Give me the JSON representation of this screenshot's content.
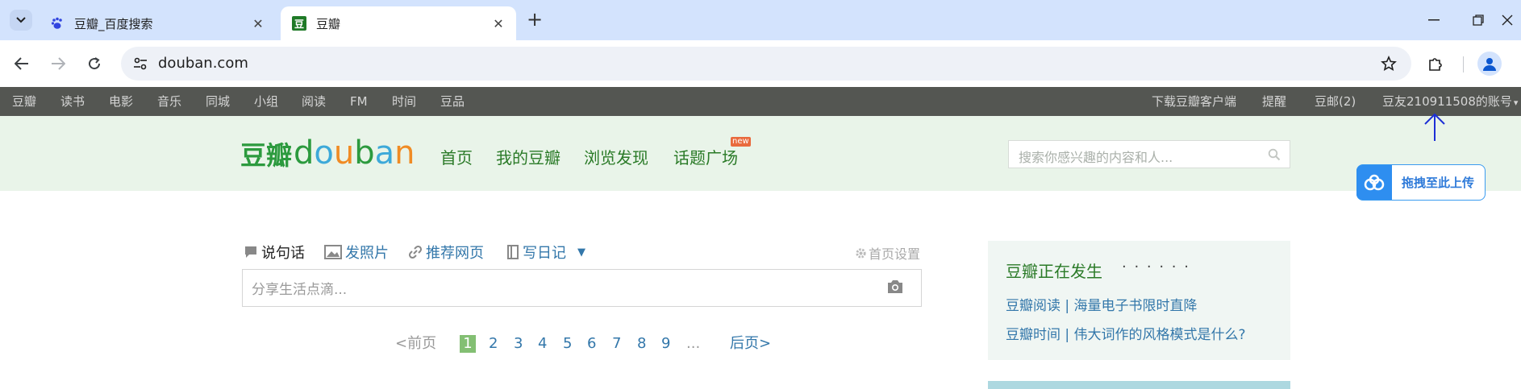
{
  "browser": {
    "tabs": [
      {
        "title": "豆瓣_百度搜索",
        "favicon": "baidu-paw-icon",
        "active": false
      },
      {
        "title": "豆瓣",
        "favicon": "douban-icon",
        "active": true
      }
    ],
    "douban_favicon_glyph": "豆",
    "url": "douban.com"
  },
  "global_nav": {
    "left": [
      "豆瓣",
      "读书",
      "电影",
      "音乐",
      "同城",
      "小组",
      "阅读",
      "FM",
      "时间",
      "豆品"
    ],
    "right": {
      "download": "下载豆瓣客户端",
      "remind": "提醒",
      "mail": "豆邮(2)",
      "account": "豆友210911508的账号",
      "account_caret": "▾"
    }
  },
  "header": {
    "logo_cn": "豆瓣",
    "logo_en_letters": [
      "d",
      "o",
      "u",
      "b",
      "a",
      "n"
    ],
    "logo_en_colors": [
      "#2c9a3e",
      "#3da9d9",
      "#f08b24",
      "#2c9a3e",
      "#3da9d9",
      "#f08b24"
    ],
    "nav": [
      "首页",
      "我的豆瓣",
      "浏览发现",
      "话题广场"
    ],
    "new_badge": "new",
    "search_placeholder": "搜索你感兴趣的内容和人..."
  },
  "upload_widget": {
    "label": "拖拽至此上传"
  },
  "composer": {
    "actions": [
      "说句话",
      "发照片",
      "推荐网页",
      "写日记"
    ],
    "caret": "▼",
    "settings": "首页设置",
    "placeholder": "分享生活点滴..."
  },
  "pager": {
    "prev": "<前页",
    "pages": [
      "1",
      "2",
      "3",
      "4",
      "5",
      "6",
      "7",
      "8",
      "9"
    ],
    "current": "1",
    "ellipsis": "...",
    "next": "后页>"
  },
  "hot": {
    "title": "豆瓣正在发生",
    "dots": "· · · · · ·",
    "links": [
      "豆瓣阅读 | 海量电子书限时直降",
      "豆瓣时间 | 伟大词作的风格模式是什么?"
    ]
  },
  "colors": {
    "tabbar": "#d3e3fd",
    "globalnav": "#545652",
    "header_bg": "#e9f4e9",
    "douban_green": "#2a7a27",
    "link_blue": "#3377aa",
    "pager_current": "#83bf73",
    "annotation_arrow": "#1d2fd6"
  }
}
